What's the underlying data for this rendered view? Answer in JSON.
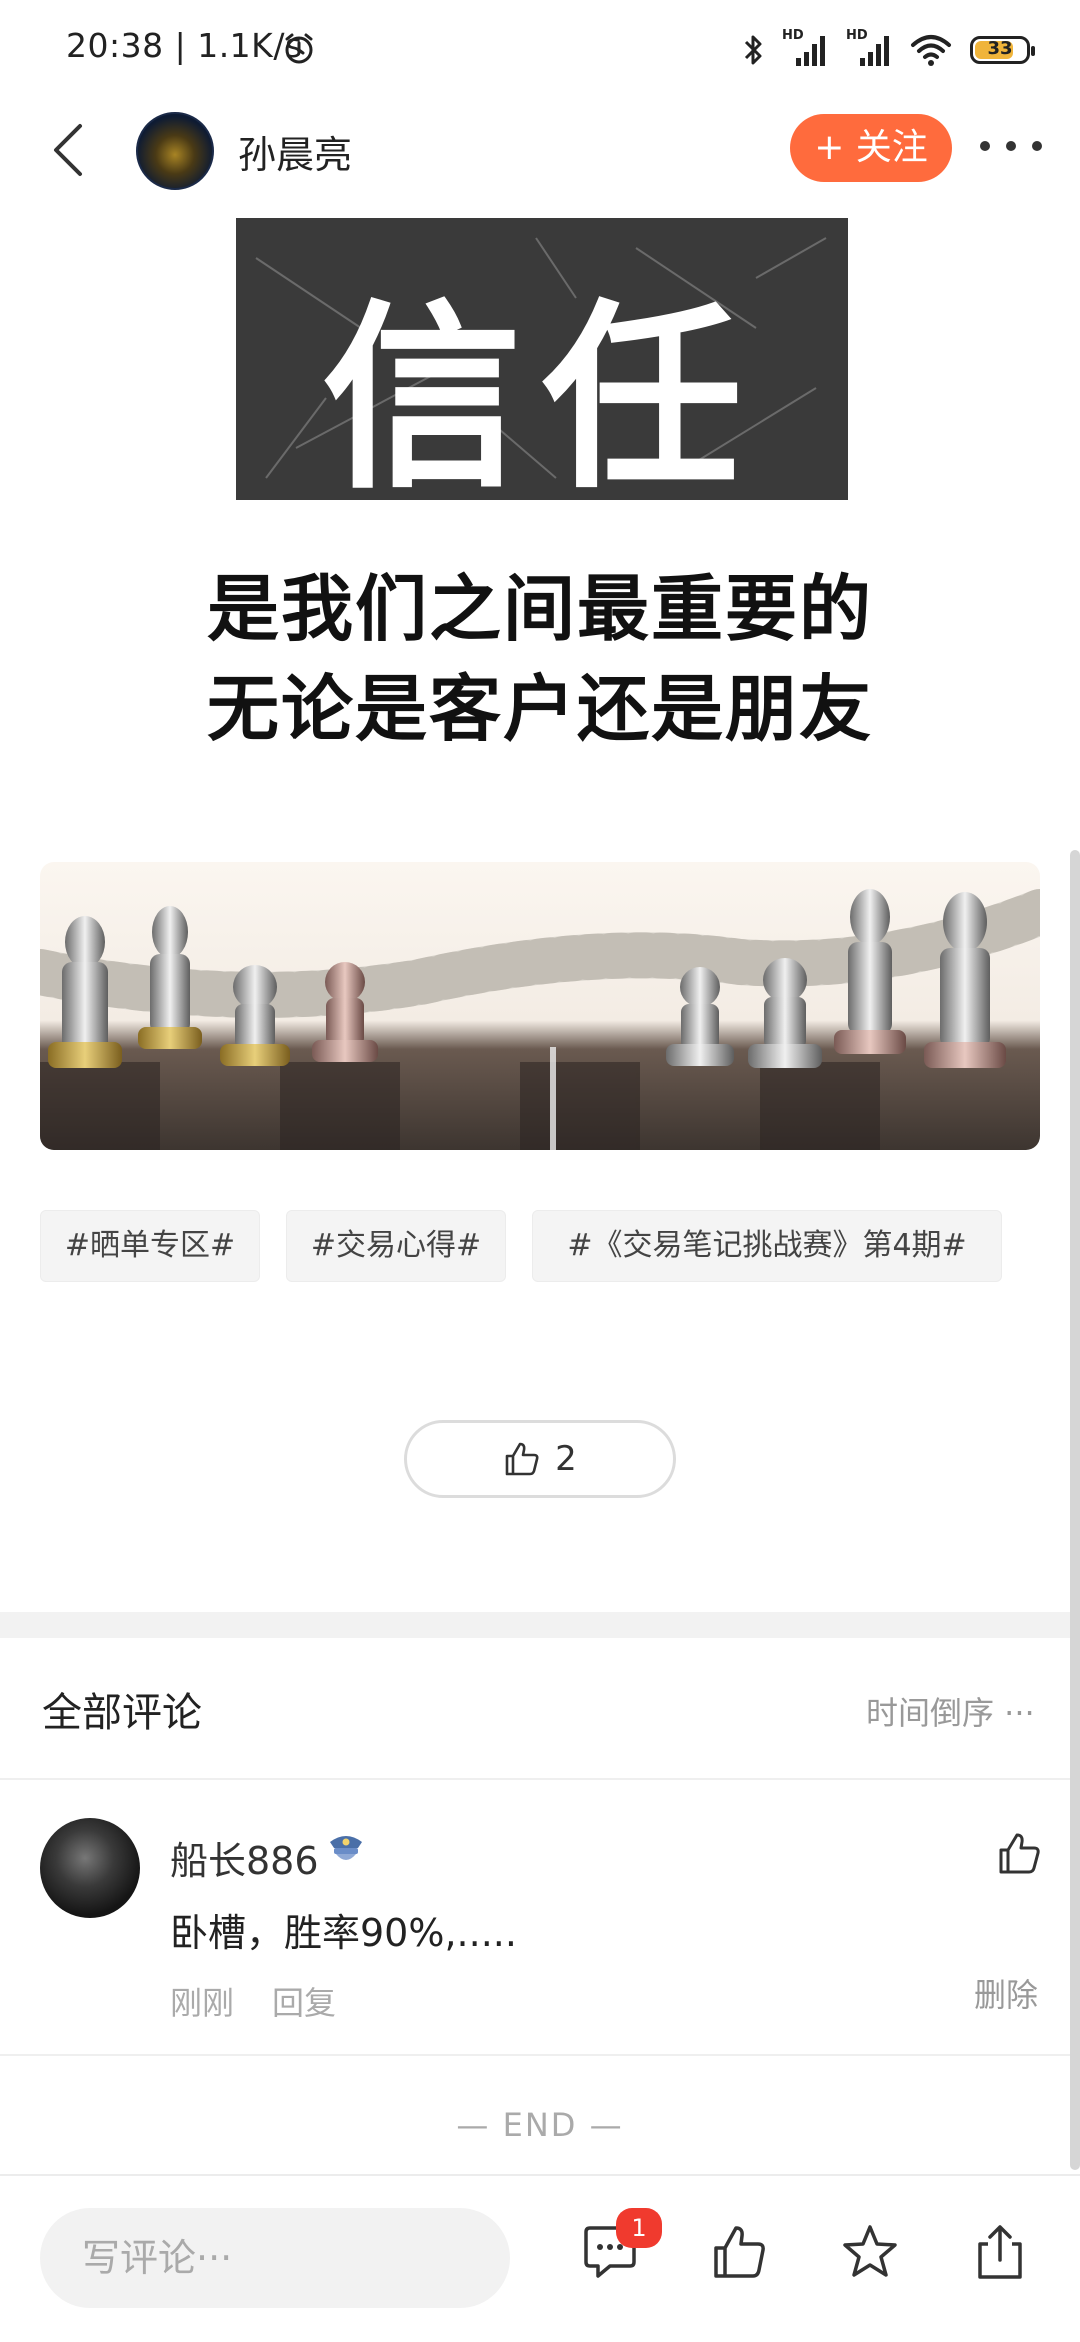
{
  "status_bar": {
    "time": "20:38 | 1.1K/s",
    "battery": "33",
    "hd1": "HD",
    "hd2": "HD"
  },
  "header": {
    "author": "孙晨亮",
    "follow_label": "+ 关注"
  },
  "post_image_text": {
    "big_word": "信任",
    "line1": "是我们之间最重要的",
    "line2": "无论是客户还是朋友"
  },
  "tags": [
    "#晒单专区#",
    "#交易心得#",
    "#《交易笔记挑战赛》第4期#"
  ],
  "like": {
    "count": "2"
  },
  "comments": {
    "title": "全部评论",
    "sort_label": "时间倒序 ···",
    "items": [
      {
        "user": "船长886",
        "text": "卧槽，胜率90%,.....",
        "time": "刚刚",
        "reply": "回复",
        "delete": "删除"
      }
    ],
    "end": "— END —"
  },
  "bottom_bar": {
    "input_placeholder": "写评论···",
    "comment_badge": "1"
  },
  "colors": {
    "accent": "#ff6b3d",
    "badge": "#f03a2e"
  },
  "icons": [
    "back-icon",
    "more-icon",
    "thumb-up-icon",
    "comment-icon",
    "star-icon",
    "share-icon",
    "bluetooth-icon",
    "wifi-icon",
    "alarm-icon"
  ]
}
